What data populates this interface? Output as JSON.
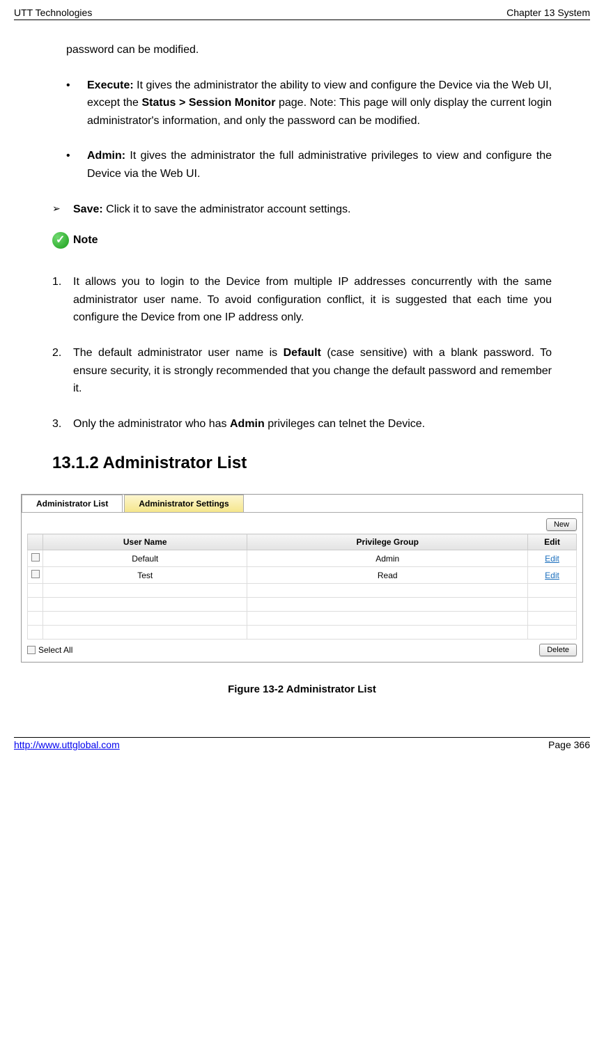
{
  "header": {
    "left": "UTT Technologies",
    "right": "Chapter 13 System"
  },
  "body": {
    "para0": "password can be modified.",
    "bullet1_label": "Execute:",
    "bullet1_text_a": " It gives the administrator the ability to view and configure the Device via the Web UI, except the ",
    "bullet1_bold": "Status > Session Monitor",
    "bullet1_text_b": " page. Note: This page will only display the current login administrator's information, and only the password can be modified.",
    "bullet2_label": "Admin:",
    "bullet2_text": " It gives the administrator the full administrative privileges to view and configure the Device via the Web UI.",
    "arrow_label": "Save:",
    "arrow_text": " Click it to save the administrator account settings.",
    "note_label": "Note",
    "num1_no": "1.",
    "num1_text": "It allows you to login to the Device from multiple IP addresses concurrently with the same administrator user name. To avoid configuration conflict, it is suggested that each time you configure the Device from one IP address only.",
    "num2_no": "2.",
    "num2_text_a": "The default administrator user name is ",
    "num2_bold": "Default",
    "num2_text_b": " (case sensitive) with a blank password. To ensure security, it is strongly recommended that you change the default password and remember it.",
    "num3_no": "3.",
    "num3_text_a": "Only the administrator who has ",
    "num3_bold": "Admin",
    "num3_text_b": " privileges can telnet the Device.",
    "section_heading": "13.1.2  Administrator List"
  },
  "screenshot": {
    "tabs": {
      "active": "Administrator List",
      "inactive": "Administrator Settings"
    },
    "new_btn": "New",
    "headers": {
      "col1": "User Name",
      "col2": "Privilege Group",
      "col3": "Edit"
    },
    "rows": [
      {
        "user": "Default",
        "group": "Admin",
        "edit": "Edit"
      },
      {
        "user": "Test",
        "group": "Read",
        "edit": "Edit"
      }
    ],
    "select_all": "Select All",
    "delete_btn": "Delete"
  },
  "figure_caption": "Figure 13-2 Administrator List",
  "footer": {
    "link": "http://www.uttglobal.com",
    "page": "Page 366"
  }
}
